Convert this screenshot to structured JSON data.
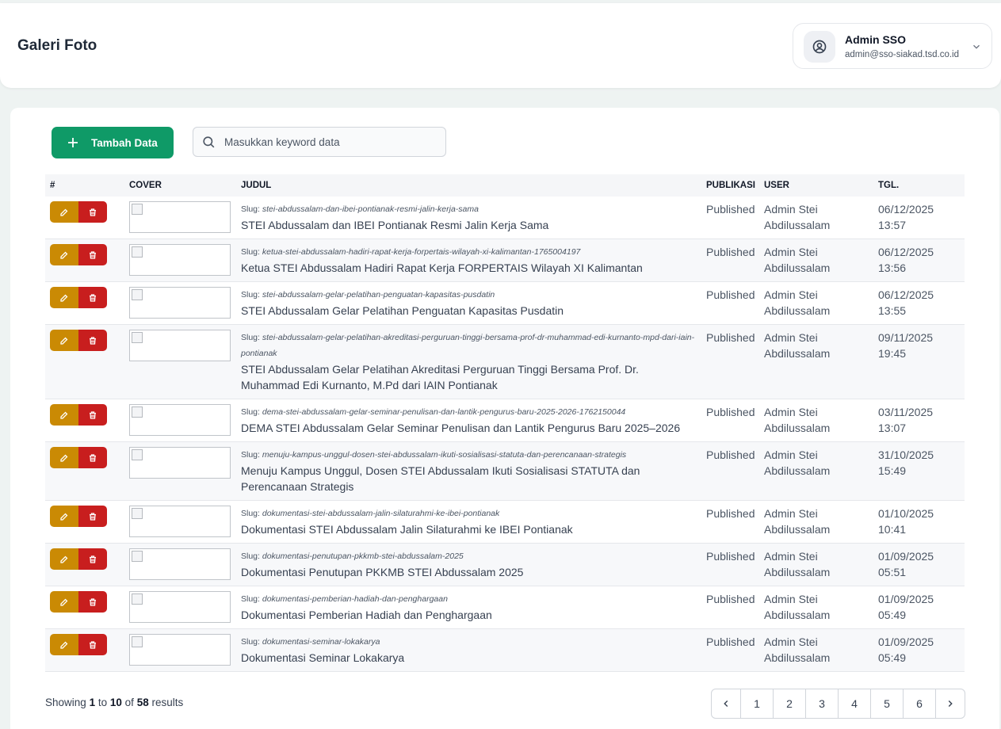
{
  "header": {
    "title": "Galeri Foto",
    "user_name": "Admin SSO",
    "user_email": "admin@sso-siakad.tsd.co.id"
  },
  "toolbar": {
    "add_label": "Tambah Data",
    "search_placeholder": "Masukkan keyword data"
  },
  "table": {
    "columns": [
      "#",
      "COVER",
      "JUDUL",
      "PUBLIKASI",
      "USER",
      "TGL."
    ],
    "slug_prefix": "Slug:",
    "rows": [
      {
        "slug": "stei-abdussalam-dan-ibei-pontianak-resmi-jalin-kerja-sama",
        "title": "STEI Abdussalam dan IBEI Pontianak Resmi Jalin Kerja Sama",
        "status": "Published",
        "user": "Admin Stei Abdilussalam",
        "date": "06/12/2025",
        "time": "13:57"
      },
      {
        "slug": "ketua-stei-abdussalam-hadiri-rapat-kerja-forpertais-wilayah-xi-kalimantan-1765004197",
        "title": "Ketua STEI Abdussalam Hadiri Rapat Kerja FORPERTAIS Wilayah XI Kalimantan",
        "status": "Published",
        "user": "Admin Stei Abdilussalam",
        "date": "06/12/2025",
        "time": "13:56"
      },
      {
        "slug": "stei-abdussalam-gelar-pelatihan-penguatan-kapasitas-pusdatin",
        "title": "STEI Abdussalam Gelar Pelatihan Penguatan Kapasitas Pusdatin",
        "status": "Published",
        "user": "Admin Stei Abdilussalam",
        "date": "06/12/2025",
        "time": "13:55"
      },
      {
        "slug": "stei-abdussalam-gelar-pelatihan-akreditasi-perguruan-tinggi-bersama-prof-dr-muhammad-edi-kurnanto-mpd-dari-iain-pontianak",
        "title": "STEI Abdussalam Gelar Pelatihan Akreditasi Perguruan Tinggi Bersama Prof. Dr. Muhammad Edi Kurnanto, M.Pd dari IAIN Pontianak",
        "status": "Published",
        "user": "Admin Stei Abdilussalam",
        "date": "09/11/2025",
        "time": "19:45"
      },
      {
        "slug": "dema-stei-abdussalam-gelar-seminar-penulisan-dan-lantik-pengurus-baru-2025-2026-1762150044",
        "title": "DEMA STEI Abdussalam Gelar Seminar Penulisan dan Lantik Pengurus Baru 2025–2026",
        "status": "Published",
        "user": "Admin Stei Abdilussalam",
        "date": "03/11/2025",
        "time": "13:07"
      },
      {
        "slug": "menuju-kampus-unggul-dosen-stei-abdussalam-ikuti-sosialisasi-statuta-dan-perencanaan-strategis",
        "title": "Menuju Kampus Unggul, Dosen STEI Abdussalam Ikuti Sosialisasi STATUTA dan Perencanaan Strategis",
        "status": "Published",
        "user": "Admin Stei Abdilussalam",
        "date": "31/10/2025",
        "time": "15:49"
      },
      {
        "slug": "dokumentasi-stei-abdussalam-jalin-silaturahmi-ke-ibei-pontianak",
        "title": "Dokumentasi STEI Abdussalam Jalin Silaturahmi ke IBEI Pontianak",
        "status": "Published",
        "user": "Admin Stei Abdilussalam",
        "date": "01/10/2025",
        "time": "10:41"
      },
      {
        "slug": "dokumentasi-penutupan-pkkmb-stei-abdussalam-2025",
        "title": "Dokumentasi Penutupan PKKMB STEI Abdussalam 2025",
        "status": "Published",
        "user": "Admin Stei Abdilussalam",
        "date": "01/09/2025",
        "time": "05:51"
      },
      {
        "slug": "dokumentasi-pemberian-hadiah-dan-penghargaan",
        "title": "Dokumentasi Pemberian Hadiah dan Penghargaan",
        "status": "Published",
        "user": "Admin Stei Abdilussalam",
        "date": "01/09/2025",
        "time": "05:49"
      },
      {
        "slug": "dokumentasi-seminar-lokakarya",
        "title": "Dokumentasi Seminar Lokakarya",
        "status": "Published",
        "user": "Admin Stei Abdilussalam",
        "date": "01/09/2025",
        "time": "05:49"
      }
    ]
  },
  "pagination": {
    "showing_prefix": "Showing",
    "from": "1",
    "to_word": "to",
    "to": "10",
    "of_word": "of",
    "total": "58",
    "results_word": "results",
    "pages": [
      "1",
      "2",
      "3",
      "4",
      "5",
      "6"
    ]
  },
  "colors": {
    "accent_green": "#0f9a67",
    "edit_yellow": "#ca8a04",
    "delete_red": "#c81e1e"
  },
  "icons": [
    "user-circle-icon",
    "chevron-down-icon",
    "plus-icon",
    "search-icon",
    "edit-icon",
    "trash-icon",
    "chevron-left-icon",
    "chevron-right-icon"
  ]
}
